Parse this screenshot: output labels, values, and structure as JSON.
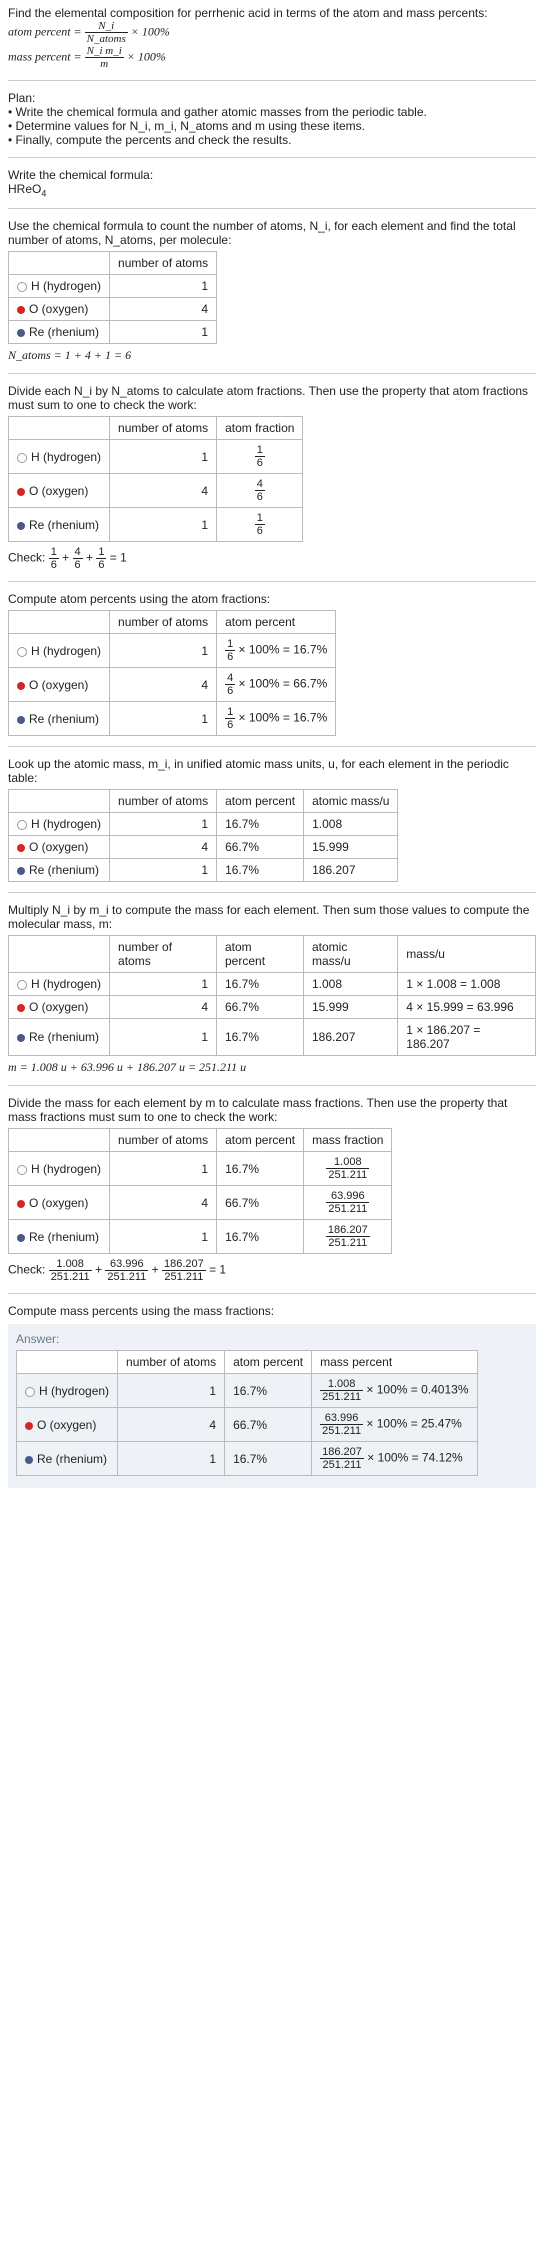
{
  "intro": {
    "line1": "Find the elemental composition for perrhenic acid in terms of the atom and mass percents:",
    "atom_formula_lhs": "atom percent = ",
    "atom_formula_frac_n": "N_i",
    "atom_formula_frac_d": "N_atoms",
    "atom_formula_rhs": " × 100%",
    "mass_formula_lhs": "mass percent = ",
    "mass_formula_frac_n": "N_i m_i",
    "mass_formula_frac_d": "m",
    "mass_formula_rhs": " × 100%"
  },
  "plan": {
    "title": "Plan:",
    "b1": "• Write the chemical formula and gather atomic masses from the periodic table.",
    "b2": "• Determine values for N_i, m_i, N_atoms and m using these items.",
    "b3": "• Finally, compute the percents and check the results."
  },
  "cf": {
    "title": "Write the chemical formula:",
    "value": "HReO",
    "sub": "4"
  },
  "cnt": {
    "text": "Use the chemical formula to count the number of atoms, N_i, for each element and find the total number of atoms, N_atoms, per molecule:",
    "h2": "number of atoms",
    "h": "H (hydrogen)",
    "o": "O (oxygen)",
    "re": "Re (rhenium)",
    "nh": "1",
    "no": "4",
    "nre": "1",
    "total": "N_atoms = 1 + 4 + 1 = 6"
  },
  "af": {
    "text": "Divide each N_i by N_atoms to calculate atom fractions. Then use the property that atom fractions must sum to one to check the work:",
    "h3": "atom fraction",
    "fh_n": "1",
    "fh_d": "6",
    "fo_n": "4",
    "fo_d": "6",
    "fre_n": "1",
    "fre_d": "6",
    "check": "Check: ",
    "check_rhs": " = 1"
  },
  "ap": {
    "text": "Compute atom percents using the atom fractions:",
    "h3": "atom percent",
    "ph": " × 100% = 16.7%",
    "po": " × 100% = 66.7%",
    "pre": " × 100% = 16.7%"
  },
  "am": {
    "text": "Look up the atomic mass, m_i, in unified atomic mass units, u, for each element in the periodic table:",
    "h4": "atomic mass/u",
    "mh": "1.008",
    "mo": "15.999",
    "mre": "186.207",
    "aph": "16.7%",
    "apo": "66.7%",
    "apre": "16.7%"
  },
  "mc": {
    "text": "Multiply N_i by m_i to compute the mass for each element. Then sum those values to compute the molecular mass, m:",
    "h5": "mass/u",
    "rh": "1 × 1.008 = 1.008",
    "ro": "4 × 15.999 = 63.996",
    "rre": "1 × 186.207 = 186.207",
    "total": "m = 1.008 u + 63.996 u + 186.207 u = 251.211 u"
  },
  "mf": {
    "text": "Divide the mass for each element by m to calculate mass fractions. Then use the property that mass fractions must sum to one to check the work:",
    "h6": "mass fraction",
    "fh_n": "1.008",
    "fo_n": "63.996",
    "fre_n": "186.207",
    "den": "251.211",
    "check": "Check: ",
    "check_rhs": " = 1"
  },
  "mp": {
    "text": "Compute mass percents using the mass fractions:"
  },
  "ans": {
    "label": "Answer:",
    "h3": "atom percent",
    "h4": "mass percent",
    "ph": "16.7%",
    "po": "66.7%",
    "pre": "16.7%",
    "mh_rhs": " × 100% = 0.4013%",
    "mo_rhs": " × 100% = 25.47%",
    "mre_rhs": " × 100% = 74.12%"
  }
}
